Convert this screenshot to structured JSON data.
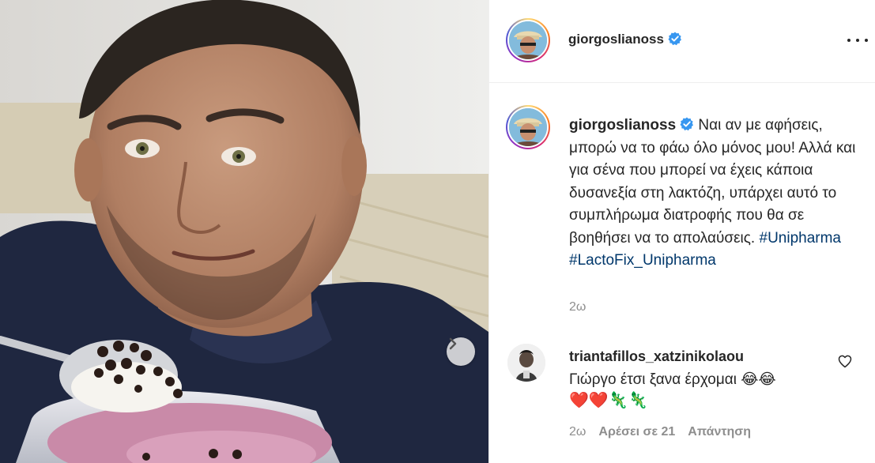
{
  "post": {
    "username": "giorgoslianoss",
    "verified": true,
    "more_icon": "more-horizontal-icon",
    "next_icon": "chevron-right-icon"
  },
  "caption": {
    "username": "giorgoslianoss",
    "text": "Ναι αν με αφήσεις, μπορώ να το φάω όλο μόνος μου! Αλλά και για σένα που μπορεί να έχεις κάποια δυσανεξία στη λακτόζη, υπάρχει αυτό το συμπλήρωμα διατροφής που θα σε βοηθήσει να το απολαύσεις. ",
    "hashtags": [
      "#Unipharma",
      "#LactoFix_Unipharma"
    ],
    "time": "2ω"
  },
  "comment": {
    "username": "triantafillos_xatzinikolaou",
    "text": "Γιώργο έτσι ξανα έρχομαι 😂😂",
    "emojis": "❤️❤️🦎🦎",
    "time": "2ω",
    "likes": "Αρέσει σε 21",
    "reply": "Απάντηση",
    "like_icon": "heart-outline-icon"
  },
  "colors": {
    "verified": "#3897f0",
    "hashtag": "#00376b",
    "muted": "#8e8e8e",
    "text": "#262626"
  }
}
